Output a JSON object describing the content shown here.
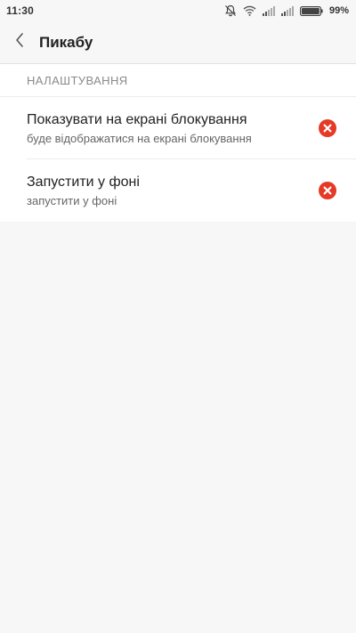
{
  "status_bar": {
    "time": "11:30",
    "battery_percent": "99%",
    "battery_level": 0.99,
    "icons": [
      "notifications-off-icon",
      "wifi-icon",
      "signal-icon",
      "signal-icon",
      "battery-icon"
    ]
  },
  "app_bar": {
    "title": "Пикабу",
    "back_icon": "chevron-left-icon"
  },
  "settings": {
    "section_title": "НАЛАШТУВАННЯ",
    "items": [
      {
        "title": "Показувати на екрані блокування",
        "summary": "буде відображатися на екрані блокування",
        "status_icon": "disabled-x-icon"
      },
      {
        "title": "Запустити у фоні",
        "summary": "запустити у фоні",
        "status_icon": "disabled-x-icon"
      }
    ]
  },
  "colors": {
    "background": "#f7f7f7",
    "card": "#ffffff",
    "status_disabled": "#e53a26",
    "section_text": "#8a8a8a"
  }
}
